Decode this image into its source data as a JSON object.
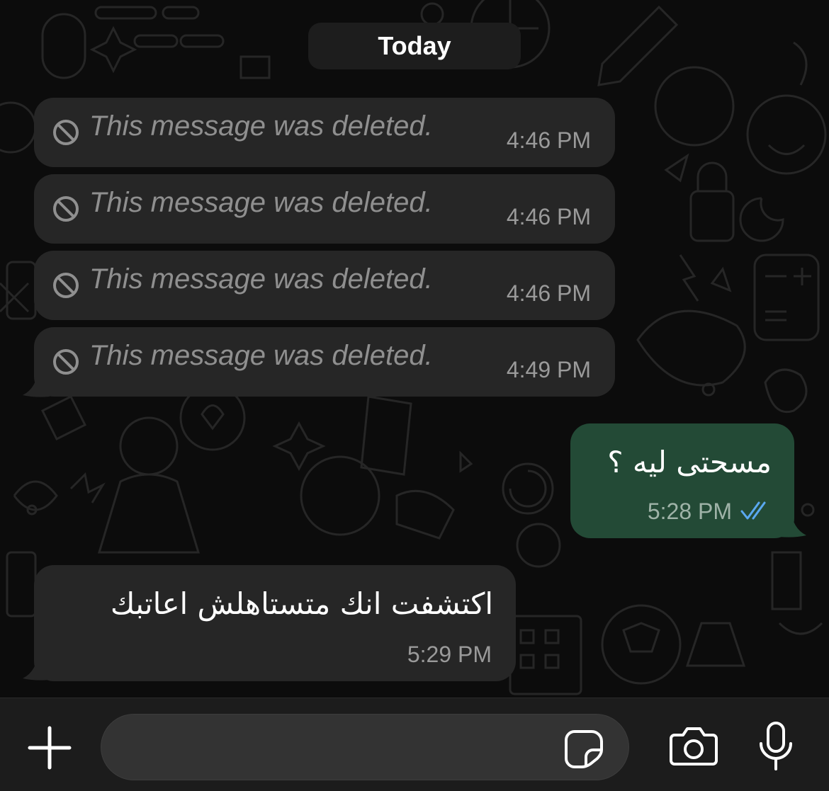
{
  "chat": {
    "date_label": "Today",
    "deleted_messages": [
      {
        "text": "This message was deleted.",
        "time": "4:46 PM"
      },
      {
        "text": "This message was deleted.",
        "time": "4:46 PM"
      },
      {
        "text": "This message was deleted.",
        "time": "4:46 PM"
      },
      {
        "text": "This message was deleted.",
        "time": "4:49 PM"
      }
    ],
    "outgoing": {
      "text": "مسحتى ليه ؟",
      "time": "5:28 PM",
      "status": "read"
    },
    "incoming": {
      "text": "اكتشفت انك متستاهلش اعاتبك",
      "time": "5:29 PM"
    }
  },
  "composer": {
    "input_value": "",
    "icons": [
      "plus-icon",
      "sticker-icon",
      "camera-icon",
      "microphone-icon"
    ]
  },
  "colors": {
    "incoming_bubble": "#262626",
    "outgoing_bubble": "#234a36",
    "read_ticks": "#5aa8f0",
    "background": "#0c0c0c"
  }
}
